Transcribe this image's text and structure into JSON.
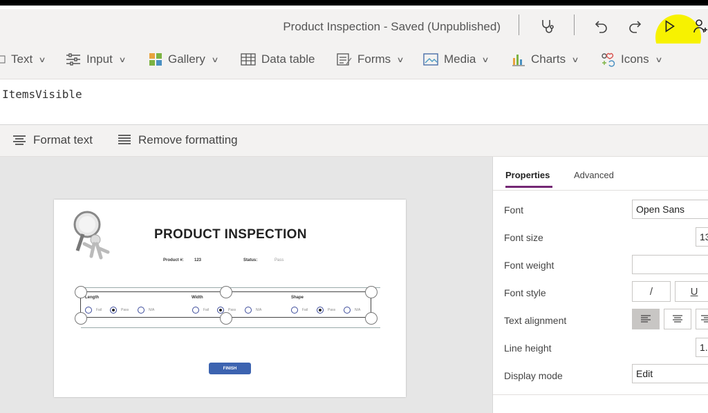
{
  "titlebar": {
    "title": "Product Inspection - Saved (Unpublished)",
    "icons": [
      "stethoscope-icon",
      "undo-icon",
      "redo-icon",
      "play-icon",
      "share-user-icon"
    ],
    "highlight_color": "#f7f200"
  },
  "ribbon": {
    "items": [
      {
        "label": "Text",
        "icon": "text-label-icon",
        "dropdown": true
      },
      {
        "label": "Input",
        "icon": "input-sliders-icon",
        "dropdown": true
      },
      {
        "label": "Gallery",
        "icon": "gallery-icon",
        "dropdown": true
      },
      {
        "label": "Data table",
        "icon": "data-table-icon",
        "dropdown": false
      },
      {
        "label": "Forms",
        "icon": "forms-icon",
        "dropdown": true
      },
      {
        "label": "Media",
        "icon": "media-icon",
        "dropdown": true
      },
      {
        "label": "Charts",
        "icon": "charts-icon",
        "dropdown": true
      },
      {
        "label": "Icons",
        "icon": "icons-icon",
        "dropdown": true
      }
    ]
  },
  "formula": {
    "text": "ItemsVisible"
  },
  "format_bar": {
    "format_text": "Format text",
    "remove_formatting": "Remove formatting"
  },
  "screen": {
    "title": "PRODUCT INSPECTION",
    "product_label": "Product #:",
    "product_value": "123",
    "status_label": "Status:",
    "status_value": "Pass",
    "columns": [
      {
        "header": "Length",
        "options": [
          "Fail",
          "Pass",
          "N/A"
        ],
        "selected": 1
      },
      {
        "header": "Width",
        "options": [
          "Fail",
          "Pass",
          "N/A"
        ],
        "selected": 1
      },
      {
        "header": "Shape",
        "options": [
          "Fail",
          "Pass",
          "N/A"
        ],
        "selected": 1
      }
    ],
    "finish_button": "FINISH",
    "finish_color": "#3c63b0"
  },
  "properties": {
    "tabs": [
      "Properties",
      "Advanced"
    ],
    "active_tab": "Properties",
    "accent_color": "#742774",
    "rows": [
      {
        "label": "Font",
        "value": "Open Sans"
      },
      {
        "label": "Font size",
        "value": "13"
      },
      {
        "label": "Font weight",
        "value": ""
      },
      {
        "label": "Font style",
        "buttons": [
          "/",
          "U"
        ]
      },
      {
        "label": "Text alignment",
        "buttons": [
          "align-left-icon",
          "align-center-icon",
          "align-right-icon"
        ]
      },
      {
        "label": "Line height",
        "value": "1."
      },
      {
        "label": "Display mode",
        "value": "Edit"
      }
    ]
  }
}
